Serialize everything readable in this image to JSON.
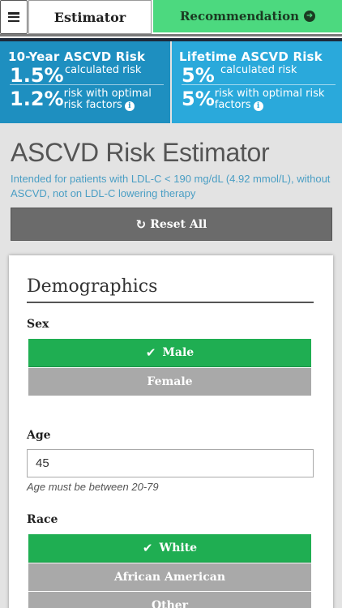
{
  "nav": {
    "estimator_tab": "Estimator",
    "recommendation_tab": "Recommendation"
  },
  "risk": {
    "ten_year": {
      "title": "10-Year ASCVD Risk",
      "calculated_value": "1.5%",
      "calculated_label": "calculated risk",
      "optimal_value": "1.2%",
      "optimal_label": "risk with optimal risk factors"
    },
    "lifetime": {
      "title": "Lifetime ASCVD Risk",
      "calculated_value": "5%",
      "calculated_label": "calculated risk",
      "optimal_value": "5%",
      "optimal_label": "risk with optimal risk factors"
    }
  },
  "page": {
    "title": "ASCVD Risk Estimator",
    "subtitle": "Intended for patients with LDL-C < 190 mg/dL (4.92 mmol/L), without ASCVD, not on LDL-C lowering therapy",
    "reset_label": "Reset All"
  },
  "demographics": {
    "title": "Demographics",
    "sex": {
      "label": "Sex",
      "options": [
        "Male",
        "Female"
      ],
      "selected": "Male"
    },
    "age": {
      "label": "Age",
      "value": "45",
      "hint": "Age must be between 20-79"
    },
    "race": {
      "label": "Race",
      "options": [
        "White",
        "African American",
        "Other"
      ],
      "selected": "White"
    }
  },
  "colors": {
    "recommendation_green": "#4cd97f",
    "selected_green": "#1fae52",
    "unselected_gray": "#a9a9a9",
    "risk_blue_dark": "#1e8fc0",
    "risk_blue_light": "#2aa9db",
    "subtitle_blue": "#4a9ec4"
  }
}
